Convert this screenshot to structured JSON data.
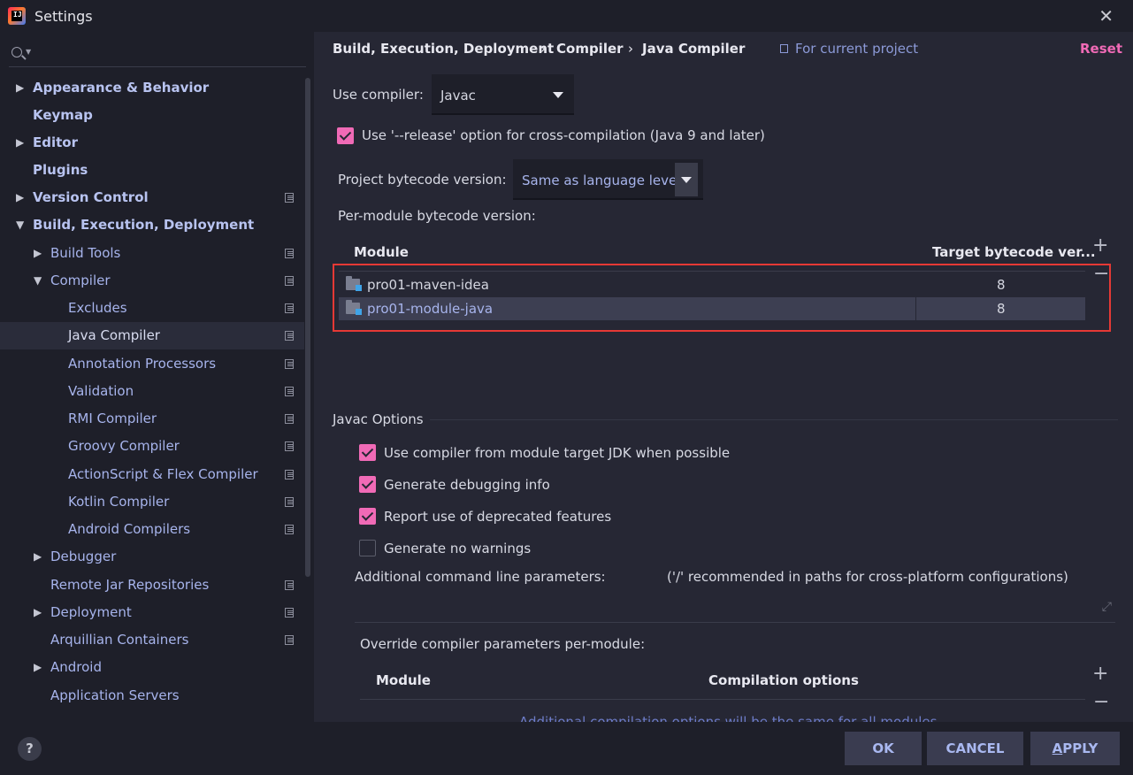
{
  "window": {
    "title": "Settings"
  },
  "sidebar": {
    "items": [
      {
        "label": "Appearance & Behavior"
      },
      {
        "label": "Keymap"
      },
      {
        "label": "Editor"
      },
      {
        "label": "Plugins"
      },
      {
        "label": "Version Control"
      },
      {
        "label": "Build, Execution, Deployment"
      },
      {
        "label": "Build Tools"
      },
      {
        "label": "Compiler"
      },
      {
        "label": "Excludes"
      },
      {
        "label": "Java Compiler"
      },
      {
        "label": "Annotation Processors"
      },
      {
        "label": "Validation"
      },
      {
        "label": "RMI Compiler"
      },
      {
        "label": "Groovy Compiler"
      },
      {
        "label": "ActionScript & Flex Compiler"
      },
      {
        "label": "Kotlin Compiler"
      },
      {
        "label": "Android Compilers"
      },
      {
        "label": "Debugger"
      },
      {
        "label": "Remote Jar Repositories"
      },
      {
        "label": "Deployment"
      },
      {
        "label": "Arquillian Containers"
      },
      {
        "label": "Android"
      },
      {
        "label": "Application Servers"
      }
    ]
  },
  "breadcrumb": {
    "items": [
      "Build, Execution, Deployment",
      "Compiler",
      "Java Compiler"
    ],
    "separator": "›",
    "scope": "For current project"
  },
  "reset_label": "Reset",
  "use_compiler": {
    "label": "Use compiler:",
    "value": "Javac"
  },
  "release_option": {
    "label": "Use '--release' option for cross-compilation (Java 9 and later)",
    "checked": true
  },
  "project_bytecode": {
    "label": "Project bytecode version:",
    "value": "Same as language level"
  },
  "per_module": {
    "label": "Per-module bytecode version:",
    "columns": [
      "Module",
      "Target bytecode ver..."
    ],
    "rows": [
      {
        "module": "pro01-maven-idea",
        "version": "8"
      },
      {
        "module": "pro01-module-java",
        "version": "8"
      }
    ]
  },
  "javac_options": {
    "title": "Javac Options",
    "checkboxes": [
      {
        "label": "Use compiler from module target JDK when possible",
        "checked": true
      },
      {
        "label": "Generate debugging info",
        "checked": true
      },
      {
        "label": "Report use of deprecated features",
        "checked": true
      },
      {
        "label": "Generate no warnings",
        "checked": false
      }
    ],
    "additional_params_label": "Additional command line parameters:",
    "additional_params_hint": "('/' recommended in paths for cross-platform configurations)"
  },
  "override": {
    "label": "Override compiler parameters per-module:",
    "columns": [
      "Module",
      "Compilation options"
    ],
    "empty_text": "Additional compilation options will be the same for all modules"
  },
  "buttons": {
    "ok": "OK",
    "cancel": "CANCEL",
    "apply_first": "A",
    "apply_rest": "PPLY",
    "help": "?"
  },
  "colors": {
    "accent": "#f06ab6",
    "link": "#a7b4ec",
    "selection_box": "#e53935"
  }
}
